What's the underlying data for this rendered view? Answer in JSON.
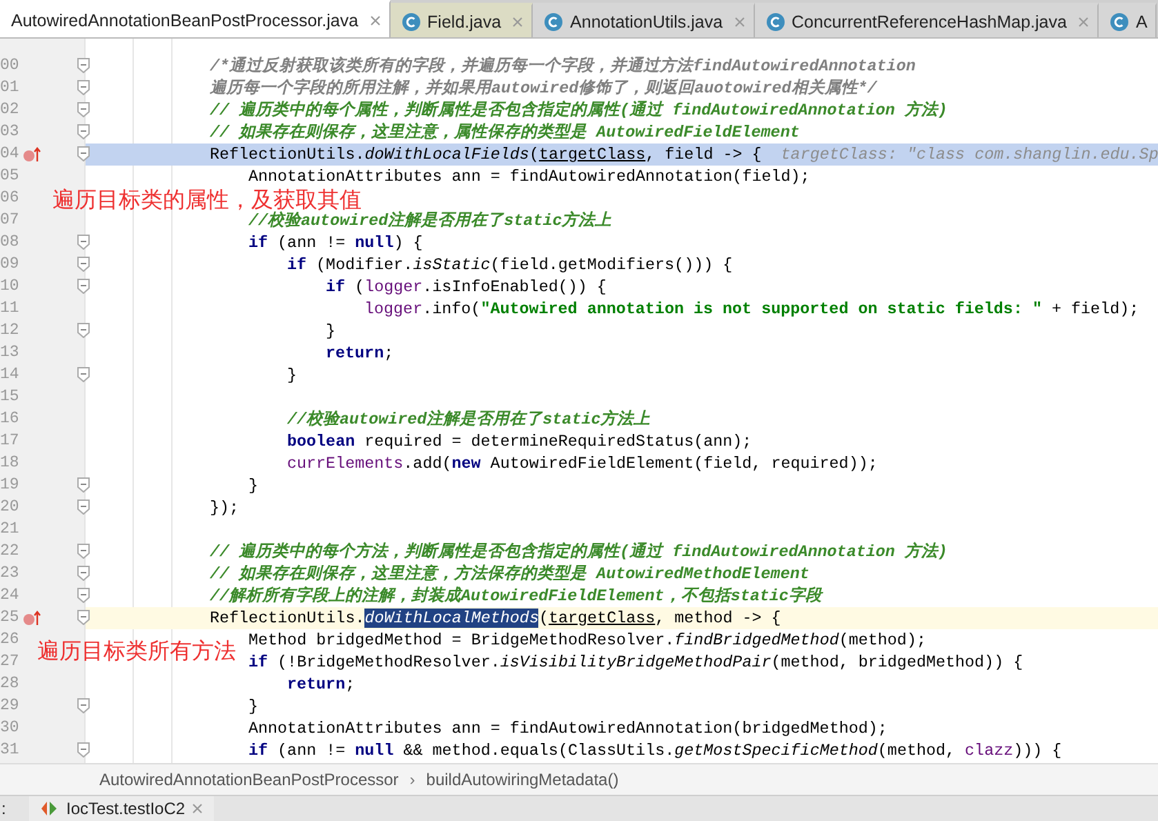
{
  "tabs": [
    {
      "label": "AutowiredAnnotationBeanPostProcessor.java",
      "icon": false,
      "selected": true,
      "closable": true,
      "color": "#ffffff"
    },
    {
      "label": "Field.java",
      "icon": true,
      "selected": false,
      "closable": true,
      "color": "#dcdcc4"
    },
    {
      "label": "AnnotationUtils.java",
      "icon": true,
      "selected": false,
      "closable": true,
      "color": "#d6d6d6"
    },
    {
      "label": "ConcurrentReferenceHashMap.java",
      "icon": true,
      "selected": false,
      "closable": true,
      "color": "#d6d6d6"
    },
    {
      "label": "A",
      "icon": true,
      "selected": false,
      "closable": false,
      "color": "#d6d6d6"
    }
  ],
  "editor": {
    "lines": [
      {
        "number": "00",
        "fold": true,
        "marker": false,
        "execution": false,
        "caret": false,
        "tokens": [
          {
            "text": "/*通过反射获取该类所有的字段，并遍历每一个字段，并通过方法findAutowiredAnnotation",
            "kind": "doc"
          }
        ]
      },
      {
        "number": "01",
        "fold": true,
        "marker": false,
        "execution": false,
        "caret": false,
        "tokens": [
          {
            "text": "遍历每一个字段的所用注解，并如果用autowired修饰了，则返回auotowired相关属性*/",
            "kind": "doc"
          }
        ]
      },
      {
        "number": "02",
        "fold": true,
        "marker": false,
        "execution": false,
        "caret": false,
        "tokens": [
          {
            "text": "// 遍历类中的每个属性，判断属性是否包含指定的属性(通过 findAutowiredAnnotation 方法)",
            "kind": "comment"
          }
        ]
      },
      {
        "number": "03",
        "fold": true,
        "marker": false,
        "execution": false,
        "caret": false,
        "tokens": [
          {
            "text": "// 如果存在则保存，这里注意，属性保存的类型是 AutowiredFieldElement",
            "kind": "comment"
          }
        ]
      },
      {
        "number": "04",
        "fold": true,
        "marker": true,
        "execution": true,
        "caret": false,
        "tokens": [
          {
            "text": "ReflectionUtils.",
            "kind": "plain"
          },
          {
            "text": "doWithLocalFields",
            "kind": "italic"
          },
          {
            "text": "(",
            "kind": "plain"
          },
          {
            "text": "targetClass",
            "kind": "underline"
          },
          {
            "text": ", field -> {",
            "kind": "plain"
          },
          {
            "text": "targetClass: \"class com.shanglin.edu.Sp",
            "kind": "hint"
          }
        ],
        "children": [
          {
            "number": "05",
            "fold": false,
            "marker": false,
            "execution": false,
            "caret": false,
            "tokens": [
              {
                "text": "AnnotationAttributes ann = findAutowiredAnnotation(field);",
                "kind": "plain"
              }
            ]
          },
          {
            "number": "06",
            "fold": false,
            "marker": false,
            "execution": false,
            "caret": false
          },
          {
            "number": "07",
            "fold": false,
            "marker": false,
            "execution": false,
            "caret": false,
            "tokens": [
              {
                "text": "//校验autowired注解是否用在了static方法上",
                "kind": "comment"
              }
            ]
          },
          {
            "number": "08",
            "fold": true,
            "marker": false,
            "execution": false,
            "caret": false,
            "tokens": [
              {
                "text": "if",
                "kind": "keyword"
              },
              {
                "text": " (ann != ",
                "kind": "plain"
              },
              {
                "text": "null",
                "kind": "keyword"
              },
              {
                "text": ") {",
                "kind": "plain"
              }
            ],
            "children": [
              {
                "number": "09",
                "fold": true,
                "marker": false,
                "execution": false,
                "caret": false,
                "tokens": [
                  {
                    "text": "if",
                    "kind": "keyword"
                  },
                  {
                    "text": " (Modifier.",
                    "kind": "plain"
                  },
                  {
                    "text": "isStatic",
                    "kind": "italic"
                  },
                  {
                    "text": "(field.getModifiers())) {",
                    "kind": "plain"
                  }
                ],
                "children": [
                  {
                    "number": "10",
                    "fold": true,
                    "marker": false,
                    "execution": false,
                    "caret": false,
                    "tokens": [
                      {
                        "text": "if",
                        "kind": "keyword"
                      },
                      {
                        "text": " (",
                        "kind": "plain"
                      },
                      {
                        "text": "logger",
                        "kind": "field"
                      },
                      {
                        "text": ".isInfoEnabled()) {",
                        "kind": "plain"
                      }
                    ],
                    "children": [
                      {
                        "number": "11",
                        "fold": false,
                        "marker": false,
                        "execution": false,
                        "caret": false,
                        "tokens": [
                          {
                            "text": "logger",
                            "kind": "field"
                          },
                          {
                            "text": ".info(",
                            "kind": "plain"
                          },
                          {
                            "text": "\"Autowired annotation is not supported on static fields: \"",
                            "kind": "string"
                          },
                          {
                            "text": " + field);",
                            "kind": "plain"
                          }
                        ]
                      }
                    ]
                  },
                  {
                    "number": "12",
                    "fold": true,
                    "marker": false,
                    "execution": false,
                    "caret": false,
                    "tokens": [
                      {
                        "text": "}",
                        "kind": "plain"
                      }
                    ]
                  },
                  {
                    "number": "13",
                    "fold": false,
                    "marker": false,
                    "execution": false,
                    "caret": false,
                    "tokens": [
                      {
                        "text": "return",
                        "kind": "keyword"
                      },
                      {
                        "text": ";",
                        "kind": "plain"
                      }
                    ]
                  }
                ]
              },
              {
                "number": "14",
                "fold": true,
                "marker": false,
                "execution": false,
                "caret": false,
                "tokens": [
                  {
                    "text": "}",
                    "kind": "plain"
                  }
                ]
              },
              {
                "number": "15",
                "fold": false,
                "marker": false,
                "execution": false,
                "caret": false
              },
              {
                "number": "16",
                "fold": false,
                "marker": false,
                "execution": false,
                "caret": false,
                "tokens": [
                  {
                    "text": "//校验autowired注解是否用在了static方法上",
                    "kind": "comment"
                  }
                ]
              },
              {
                "number": "17",
                "fold": false,
                "marker": false,
                "execution": false,
                "caret": false,
                "tokens": [
                  {
                    "text": "boolean",
                    "kind": "keyword"
                  },
                  {
                    "text": " required = determineRequiredStatus(ann);",
                    "kind": "plain"
                  }
                ]
              },
              {
                "number": "18",
                "fold": false,
                "marker": false,
                "execution": false,
                "caret": false,
                "tokens": [
                  {
                    "text": "currElements",
                    "kind": "field"
                  },
                  {
                    "text": ".add(",
                    "kind": "plain"
                  },
                  {
                    "text": "new",
                    "kind": "keyword"
                  },
                  {
                    "text": " AutowiredFieldElement(field, required));",
                    "kind": "plain"
                  }
                ]
              }
            ]
          },
          {
            "number": "19",
            "fold": true,
            "marker": false,
            "execution": false,
            "caret": false,
            "tokens": [
              {
                "text": "}",
                "kind": "plain"
              }
            ]
          }
        ]
      },
      {
        "number": "20",
        "fold": true,
        "marker": false,
        "execution": false,
        "caret": false,
        "tokens": [
          {
            "text": "});",
            "kind": "plain"
          }
        ]
      },
      {
        "number": "21",
        "fold": false,
        "marker": false,
        "execution": false,
        "caret": false
      },
      {
        "number": "22",
        "fold": true,
        "marker": false,
        "execution": false,
        "caret": false,
        "tokens": [
          {
            "text": "// 遍历类中的每个方法，判断属性是否包含指定的属性(通过 findAutowiredAnnotation 方法)",
            "kind": "comment"
          }
        ]
      },
      {
        "number": "23",
        "fold": true,
        "marker": false,
        "execution": false,
        "caret": false,
        "tokens": [
          {
            "text": "// 如果存在则保存，这里注意，方法保存的类型是 AutowiredMethodElement",
            "kind": "comment"
          }
        ]
      },
      {
        "number": "24",
        "fold": true,
        "marker": false,
        "execution": false,
        "caret": false,
        "tokens": [
          {
            "text": "//解析所有字段上的注解，封装成AutowiredFieldElement，不包括static字段",
            "kind": "comment"
          }
        ]
      },
      {
        "number": "25",
        "fold": true,
        "marker": true,
        "execution": false,
        "caret": true,
        "tokens": [
          {
            "text": "ReflectionUtils.",
            "kind": "plain"
          },
          {
            "text": "doWithLocalMethods",
            "kind": "selected"
          },
          {
            "text": "(",
            "kind": "plain"
          },
          {
            "text": "targetClass",
            "kind": "underline"
          },
          {
            "text": ", method -> {",
            "kind": "plain"
          }
        ],
        "children": [
          {
            "number": "26",
            "fold": false,
            "marker": false,
            "execution": false,
            "caret": false,
            "tokens": [
              {
                "text": "Method bridgedMethod = BridgeMethodResolver.",
                "kind": "plain"
              },
              {
                "text": "findBridgedMethod",
                "kind": "italic"
              },
              {
                "text": "(method);",
                "kind": "plain"
              }
            ]
          },
          {
            "number": "27",
            "fold": false,
            "marker": false,
            "execution": false,
            "caret": false,
            "tokens": [
              {
                "text": "if",
                "kind": "keyword"
              },
              {
                "text": " (!BridgeMethodResolver.",
                "kind": "plain"
              },
              {
                "text": "isVisibilityBridgeMethodPair",
                "kind": "italic"
              },
              {
                "text": "(method, bridgedMethod)) {",
                "kind": "plain"
              }
            ],
            "children": [
              {
                "number": "28",
                "fold": false,
                "marker": false,
                "execution": false,
                "caret": false,
                "tokens": [
                  {
                    "text": "return",
                    "kind": "keyword"
                  },
                  {
                    "text": ";",
                    "kind": "plain"
                  }
                ]
              }
            ]
          },
          {
            "number": "29",
            "fold": true,
            "marker": false,
            "execution": false,
            "caret": false,
            "tokens": [
              {
                "text": "}",
                "kind": "plain"
              }
            ]
          },
          {
            "number": "30",
            "fold": false,
            "marker": false,
            "execution": false,
            "caret": false,
            "tokens": [
              {
                "text": "AnnotationAttributes ann = findAutowiredAnnotation(bridgedMethod);",
                "kind": "plain"
              }
            ]
          },
          {
            "number": "31",
            "fold": true,
            "marker": false,
            "execution": false,
            "caret": false,
            "tokens": [
              {
                "text": "if",
                "kind": "keyword"
              },
              {
                "text": " (ann != ",
                "kind": "plain"
              },
              {
                "text": "null",
                "kind": "keyword"
              },
              {
                "text": " && method.equals(ClassUtils.",
                "kind": "plain"
              },
              {
                "text": "getMostSpecificMethod",
                "kind": "italic"
              },
              {
                "text": "(method, ",
                "kind": "plain"
              },
              {
                "text": "clazz",
                "kind": "field"
              },
              {
                "text": "))) {",
                "kind": "plain"
              }
            ]
          }
        ]
      }
    ],
    "notes": [
      "遍历目标类的属性，及获取其值",
      "遍历目标类所有方法"
    ]
  },
  "breadcrumbs": {
    "items": [
      "AutowiredAnnotationBeanPostProcessor",
      "buildAutowiringMetadata()"
    ],
    "separator": "›"
  },
  "bottom_bar": {
    "prefix": ":",
    "run_tab": "IocTest.testIoC2"
  }
}
